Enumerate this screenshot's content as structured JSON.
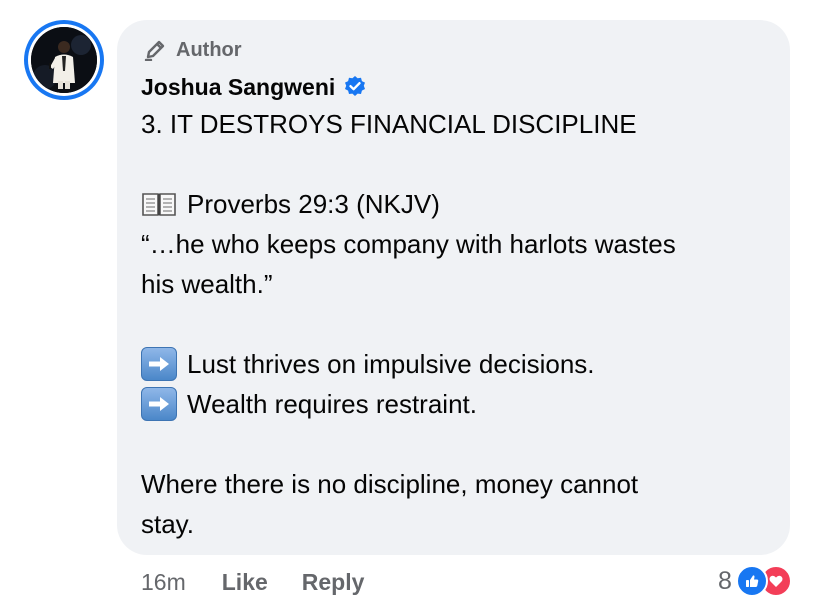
{
  "comment": {
    "author_badge": "Author",
    "author_name": "Joshua Sangweni",
    "verified": true,
    "lines": {
      "heading": "3. IT DESTROYS FINANCIAL DISCIPLINE",
      "reference": "Proverbs 29:3 (NKJV)",
      "quote_1": "“…he who keeps company with harlots wastes",
      "quote_2": "his wealth.”",
      "point_1": "Lust thrives on impulsive decisions.",
      "point_2": "Wealth requires restraint.",
      "closing_1": "Where there is no discipline, money cannot",
      "closing_2": "stay."
    },
    "icons": {
      "reference_icon": "open-book-icon",
      "point_icon": "right-arrow-icon",
      "badge_icon": "pen-icon",
      "verified_icon": "verified-badge-icon"
    }
  },
  "footer": {
    "time": "16m",
    "like_label": "Like",
    "reply_label": "Reply"
  },
  "reactions": {
    "count": "8",
    "types": [
      "like",
      "love"
    ]
  },
  "colors": {
    "accent": "#1877f2",
    "bubble": "#f0f2f5",
    "muted_text": "#65676b",
    "love": "#f33e58"
  }
}
